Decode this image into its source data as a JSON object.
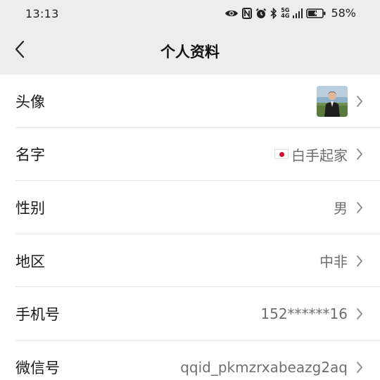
{
  "status_bar": {
    "time": "13:13",
    "network_top": "5G",
    "network_bottom": "4G",
    "battery_percent": "58%",
    "icons": [
      "eye-icon",
      "nfc-icon",
      "alarm-icon",
      "bluetooth-icon",
      "signal-icon",
      "battery-icon"
    ]
  },
  "nav": {
    "title": "个人资料",
    "back_icon": "chevron-left-icon"
  },
  "rows": [
    {
      "label": "头像",
      "value": "",
      "type": "avatar"
    },
    {
      "label": "名字",
      "value": "白手起家",
      "type": "name",
      "flag": "japan-flag-icon"
    },
    {
      "label": "性别",
      "value": "男"
    },
    {
      "label": "地区",
      "value": "中非"
    },
    {
      "label": "手机号",
      "value": "152******16"
    },
    {
      "label": "微信号",
      "value": "qqid_pkmzrxabeazg2aq"
    }
  ],
  "colors": {
    "header_bg": "#ededed",
    "text_primary": "#1a1a1a",
    "text_secondary": "#6f6f6f",
    "divider": "#e6e6e6",
    "flag_red": "#d0102d"
  }
}
